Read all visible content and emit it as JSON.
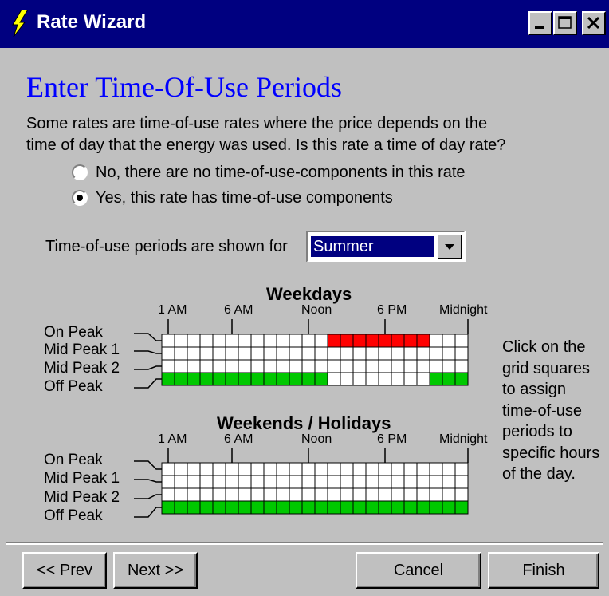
{
  "window": {
    "title": "Rate Wizard",
    "title_icon": "lightning-icon",
    "controls": [
      "minimize-icon",
      "maximize-icon",
      "close-icon"
    ]
  },
  "page": {
    "heading": "Enter Time-Of-Use Periods",
    "description_line1": "Some rates are time-of-use rates where the price depends on the",
    "description_line2": "time of day that the energy was used.  Is this rate a time of day rate?"
  },
  "radios": [
    {
      "label": "No, there are no time-of-use-components in this rate",
      "selected": false
    },
    {
      "label": "Yes, this rate has time-of-use components",
      "selected": true
    }
  ],
  "season": {
    "label": "Time-of-use periods are shown for",
    "value": "Summer"
  },
  "time_labels": [
    "1 AM",
    "6 AM",
    "Noon",
    "6 PM",
    "Midnight"
  ],
  "period_labels": [
    "On Peak",
    "Mid Peak 1",
    "Mid Peak 2",
    "Off Peak"
  ],
  "colors": {
    "on_peak": "#ff0000",
    "off_peak": "#00c800",
    "empty": "#ffffff"
  },
  "grids": [
    {
      "title": "Weekdays",
      "on_peak_hours": [
        13,
        14,
        15,
        16,
        17,
        18,
        19,
        20
      ],
      "mid_peak_1_hours": [],
      "mid_peak_2_hours": [],
      "off_peak_hours": [
        0,
        1,
        2,
        3,
        4,
        5,
        6,
        7,
        8,
        9,
        10,
        11,
        12,
        21,
        22,
        23
      ]
    },
    {
      "title": "Weekends / Holidays",
      "on_peak_hours": [],
      "mid_peak_1_hours": [],
      "mid_peak_2_hours": [],
      "off_peak_hours": [
        0,
        1,
        2,
        3,
        4,
        5,
        6,
        7,
        8,
        9,
        10,
        11,
        12,
        13,
        14,
        15,
        16,
        17,
        18,
        19,
        20,
        21,
        22,
        23
      ]
    }
  ],
  "help_text": "Click on the grid squares to assign time-of-use periods to specific hours of the day.",
  "buttons": {
    "prev": "<< Prev",
    "next": "Next >>",
    "cancel": "Cancel",
    "finish": "Finish"
  }
}
